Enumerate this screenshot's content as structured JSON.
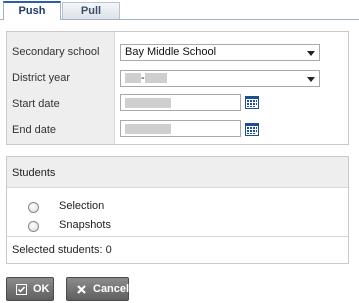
{
  "tabs": [
    {
      "label": "Push",
      "active": true
    },
    {
      "label": "Pull",
      "active": false
    }
  ],
  "form": {
    "secondary_school_label": "Secondary school",
    "secondary_school_value": "Bay Middle School",
    "district_year_label": "District year",
    "district_year_value_separator": "-",
    "start_date_label": "Start date",
    "end_date_label": "End date"
  },
  "students": {
    "title": "Students",
    "options": [
      "Selection",
      "Snapshots"
    ],
    "selected_label": "Selected students:",
    "selected_count": "0"
  },
  "buttons": {
    "ok_label": "OK",
    "cancel_label": "Cancel"
  },
  "colors": {
    "active_tab_accent": "#2a5fa8",
    "button_bg": "#707070",
    "calendar_icon": "#1f4f8c"
  }
}
